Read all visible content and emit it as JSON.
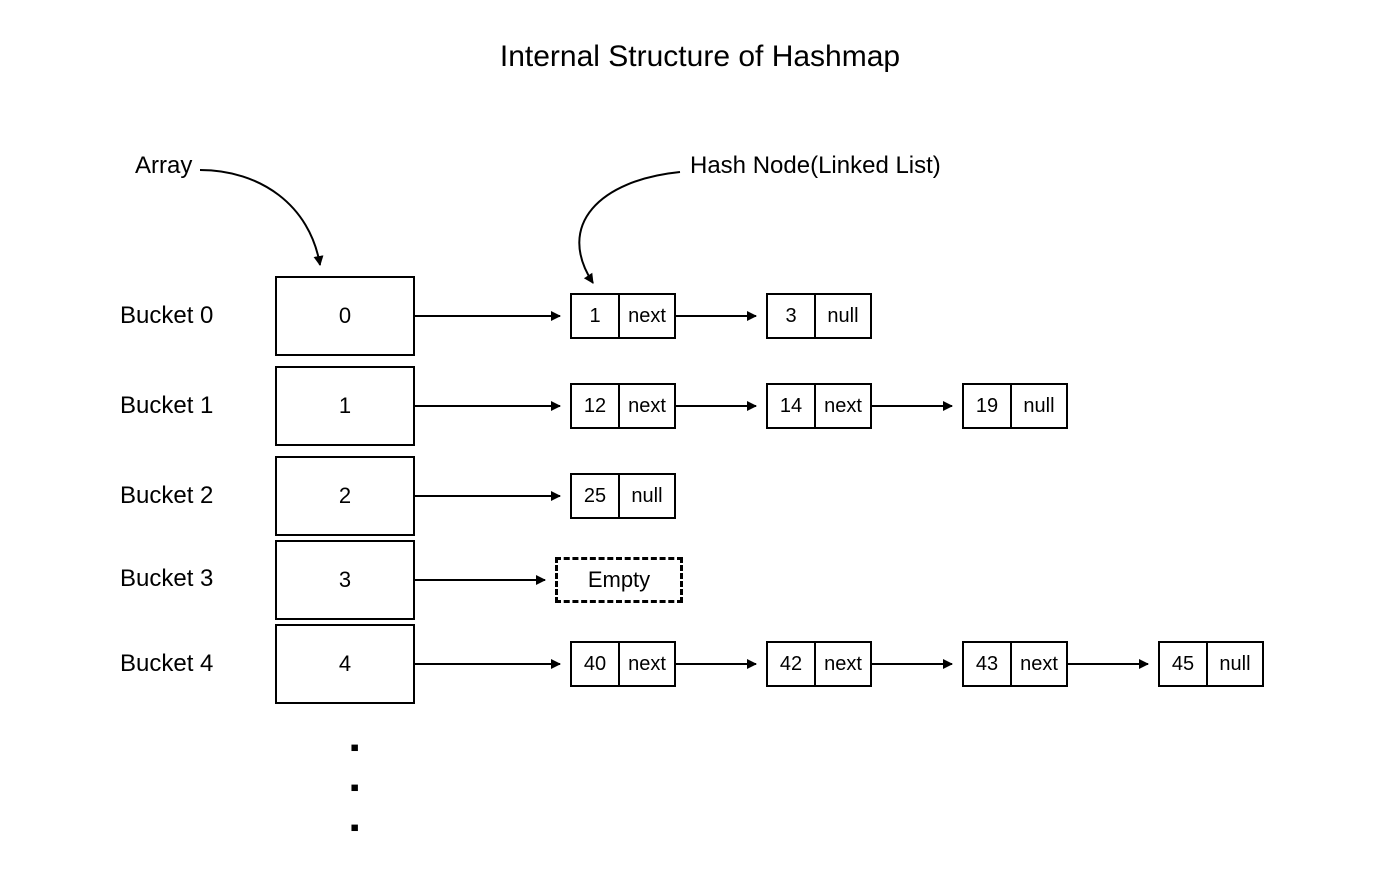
{
  "title": "Internal Structure of Hashmap",
  "labels": {
    "array": "Array",
    "hashnode": "Hash Node(Linked List)"
  },
  "buckets": [
    {
      "label": "Bucket 0",
      "index": "0"
    },
    {
      "label": "Bucket 1",
      "index": "1"
    },
    {
      "label": "Bucket 2",
      "index": "2"
    },
    {
      "label": "Bucket 3",
      "index": "3"
    },
    {
      "label": "Bucket 4",
      "index": "4"
    }
  ],
  "emptyLabel": "Empty",
  "chains": {
    "row0": [
      {
        "value": "1",
        "ptr": "next"
      },
      {
        "value": "3",
        "ptr": "null"
      }
    ],
    "row1": [
      {
        "value": "12",
        "ptr": "next"
      },
      {
        "value": "14",
        "ptr": "next"
      },
      {
        "value": "19",
        "ptr": "null"
      }
    ],
    "row2": [
      {
        "value": "25",
        "ptr": "null"
      }
    ],
    "row4": [
      {
        "value": "40",
        "ptr": "next"
      },
      {
        "value": "42",
        "ptr": "next"
      },
      {
        "value": "43",
        "ptr": "next"
      },
      {
        "value": "45",
        "ptr": "null"
      }
    ]
  },
  "dots": [
    "▪",
    "▪",
    "▪"
  ]
}
